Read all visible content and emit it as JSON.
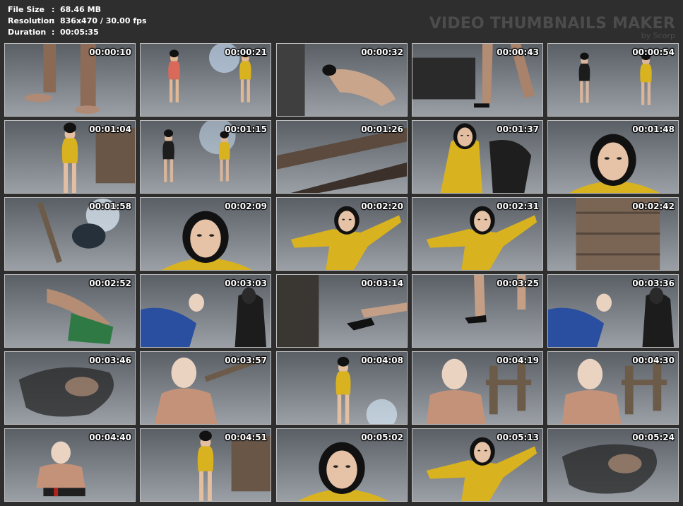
{
  "info": {
    "file_size_label": "File Size",
    "file_size_value": "68.46 MB",
    "resolution_label": "Resolution",
    "resolution_value": "836x470 / 30.00 fps",
    "duration_label": "Duration",
    "duration_value": "00:05:35",
    "separator": ":"
  },
  "watermark": {
    "title": "VIDEO THUMBNAILS MAKER",
    "byline": "by Scorp"
  },
  "thumbnails": [
    {
      "timestamp": "00:00:10",
      "scene": "bare-feet-floor"
    },
    {
      "timestamp": "00:00:21",
      "scene": "two-women-standing"
    },
    {
      "timestamp": "00:00:32",
      "scene": "woman-on-floor"
    },
    {
      "timestamp": "00:00:43",
      "scene": "legs-stepping"
    },
    {
      "timestamp": "00:00:54",
      "scene": "man-and-woman-fighting-stance"
    },
    {
      "timestamp": "00:01:04",
      "scene": "woman-yellow-suit"
    },
    {
      "timestamp": "00:01:15",
      "scene": "man-and-woman-standing"
    },
    {
      "timestamp": "00:01:26",
      "scene": "dark-ceiling"
    },
    {
      "timestamp": "00:01:37",
      "scene": "woman-grabbed"
    },
    {
      "timestamp": "00:01:48",
      "scene": "woman-face-closeup"
    },
    {
      "timestamp": "00:01:58",
      "scene": "light-and-stick"
    },
    {
      "timestamp": "00:02:09",
      "scene": "woman-face-closeup"
    },
    {
      "timestamp": "00:02:20",
      "scene": "woman-fighting-pose"
    },
    {
      "timestamp": "00:02:31",
      "scene": "woman-fighting-pose"
    },
    {
      "timestamp": "00:02:42",
      "scene": "wooden-set"
    },
    {
      "timestamp": "00:02:52",
      "scene": "legs-on-ground"
    },
    {
      "timestamp": "00:03:03",
      "scene": "masked-figures"
    },
    {
      "timestamp": "00:03:14",
      "scene": "high-heel-step"
    },
    {
      "timestamp": "00:03:25",
      "scene": "high-heels-floor"
    },
    {
      "timestamp": "00:03:36",
      "scene": "masked-figures"
    },
    {
      "timestamp": "00:03:46",
      "scene": "blurred-action"
    },
    {
      "timestamp": "00:03:57",
      "scene": "masked-man-stick"
    },
    {
      "timestamp": "00:04:08",
      "scene": "woman-standing-smoke"
    },
    {
      "timestamp": "00:04:19",
      "scene": "masked-man-chair"
    },
    {
      "timestamp": "00:04:30",
      "scene": "masked-man-chair"
    },
    {
      "timestamp": "00:04:40",
      "scene": "masked-man-sitting"
    },
    {
      "timestamp": "00:04:51",
      "scene": "woman-yellow-suit"
    },
    {
      "timestamp": "00:05:02",
      "scene": "woman-face-closeup"
    },
    {
      "timestamp": "00:05:13",
      "scene": "woman-fighting-pose"
    },
    {
      "timestamp": "00:05:24",
      "scene": "blurred-action"
    }
  ],
  "colors": {
    "background": "#2e2e2e",
    "thumbnail_border": "#bfbfbf",
    "timestamp_text": "#ffffff",
    "watermark_text": "#4c4c4c",
    "suit_yellow": "#d9b21f",
    "scene_blue": "#5f8fb8",
    "scene_dark": "#2a2a2a"
  }
}
